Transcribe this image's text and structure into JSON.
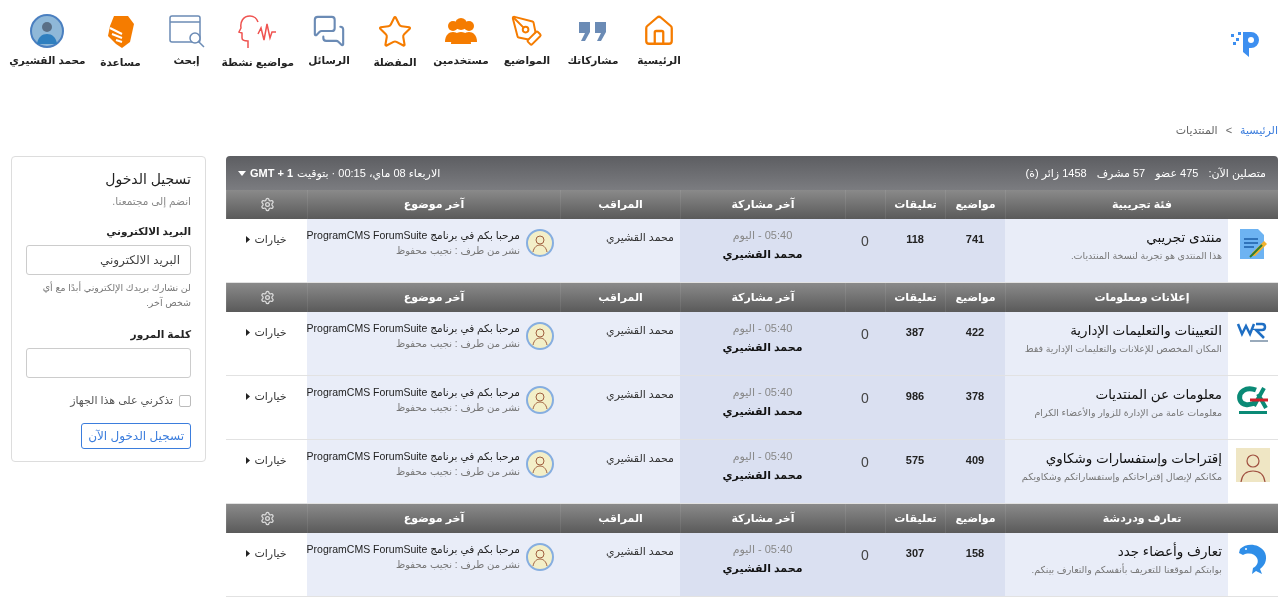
{
  "nav": {
    "items": [
      {
        "label": "الرئيسية"
      },
      {
        "label": "مشاركاتك"
      },
      {
        "label": "المواضيع"
      },
      {
        "label": "مستخدمين"
      },
      {
        "label": "المفضلة"
      },
      {
        "label": "الرسائل"
      },
      {
        "label": "مواضيع نشطة"
      },
      {
        "label": "إبحث"
      },
      {
        "label": "مساعدة"
      },
      {
        "label": "محمد القشيري"
      }
    ]
  },
  "breadcrumb": [
    {
      "label": "الرئيسية",
      "kind": "link"
    },
    {
      "label": ">",
      "kind": "separator"
    },
    {
      "label": "المنتديات",
      "kind": "current"
    }
  ],
  "stats_bar": {
    "label": "متصلين الآن:",
    "items": [
      "475 عضو",
      "57 مشرف",
      "1458 زائر (ة)"
    ],
    "datetime": "الاربعاء 08 ماي، 00:15 · بتوقيت",
    "timezone": "GMT + 1"
  },
  "categories": [
    {
      "title": "فئة تجريبية",
      "columns": {
        "topics": "مواضيع",
        "comments": "تعليقات",
        "last_post": "آخر مشاركة",
        "moderator": "المراقب",
        "last_topic": "آخر موضوع"
      },
      "forums": [
        {
          "title": "منتدى تجريبي",
          "description": "هذا المنتدى هو تجربة لنسخة المنتديات.",
          "topics": "741",
          "comments": "118",
          "users": "0",
          "last_time": "05:40 - اليوم",
          "last_user": "محمد القشيري",
          "moderator": "محمد القشيري",
          "last_topic": "مرحبا بكم في برنامج ProgramCMS ForumSuite",
          "last_topic_by": "نشر من طرف : نجيب محفوظ",
          "options": "خيارات"
        }
      ]
    },
    {
      "title": "إعلانات ومعلومات",
      "columns": {
        "topics": "مواضيع",
        "comments": "تعليقات",
        "last_post": "آخر مشاركة",
        "moderator": "المراقب",
        "last_topic": "آخر موضوع"
      },
      "forums": [
        {
          "title": "التعيينات والتعليمات الإدارية",
          "description": "المكان المخصص للإعلانات والتعليمات الإدارية فقط",
          "topics": "422",
          "comments": "387",
          "users": "0",
          "last_time": "05:40 - اليوم",
          "last_user": "محمد القشيري",
          "moderator": "محمد القشيري",
          "last_topic": "مرحبا بكم في برنامج ProgramCMS ForumSuite",
          "last_topic_by": "نشر من طرف : نجيب محفوظ",
          "options": "خيارات"
        },
        {
          "title": "معلومات عن المنتديات",
          "description": "معلومات عامة من الإدارة للزوار والأعضاء الكرام",
          "topics": "378",
          "comments": "986",
          "users": "0",
          "last_time": "05:40 - اليوم",
          "last_user": "محمد القشيري",
          "moderator": "محمد القشيري",
          "last_topic": "مرحبا بكم في برنامج ProgramCMS ForumSuite",
          "last_topic_by": "نشر من طرف : نجيب محفوظ",
          "options": "خيارات"
        },
        {
          "title": "إقتراحات وإستفسارات وشكاوي",
          "description": "مكانكم لإيصال إقتراحاتكم وإستفساراتكم وشكاويكم",
          "topics": "409",
          "comments": "575",
          "users": "0",
          "last_time": "05:40 - اليوم",
          "last_user": "محمد القشيري",
          "moderator": "محمد القشيري",
          "last_topic": "مرحبا بكم في برنامج ProgramCMS ForumSuite",
          "last_topic_by": "نشر من طرف : نجيب محفوظ",
          "options": "خيارات"
        }
      ]
    },
    {
      "title": "تعارف ودردشة",
      "columns": {
        "topics": "مواضيع",
        "comments": "تعليقات",
        "last_post": "آخر مشاركة",
        "moderator": "المراقب",
        "last_topic": "آخر موضوع"
      },
      "forums": [
        {
          "title": "تعارف وأعضاء جدد",
          "description": "بوابتكم لموقعنا للتعريف بأنفسكم والتعارف بينكم.",
          "topics": "158",
          "comments": "307",
          "users": "0",
          "last_time": "05:40 - اليوم",
          "last_user": "محمد القشيري",
          "moderator": "محمد القشيري",
          "last_topic": "مرحبا بكم في برنامج ProgramCMS ForumSuite",
          "last_topic_by": "نشر من طرف : نجيب محفوظ",
          "options": "خيارات"
        }
      ]
    }
  ],
  "login": {
    "title": "تسجيل الدخول",
    "subtitle": "انضم إلى مجتمعنا.",
    "email_label": "البريد الالكتروني",
    "email_placeholder": "البريد الالكتروني",
    "email_help": "لن نشارك بريدك الإلكتروني أبدًا مع أي شخص آخر.",
    "password_label": "كلمة المرور",
    "remember": {
      "label": "تذكرني على هذا الجهاز",
      "checked": false
    },
    "submit": "تسجيل الدخول الآن"
  }
}
